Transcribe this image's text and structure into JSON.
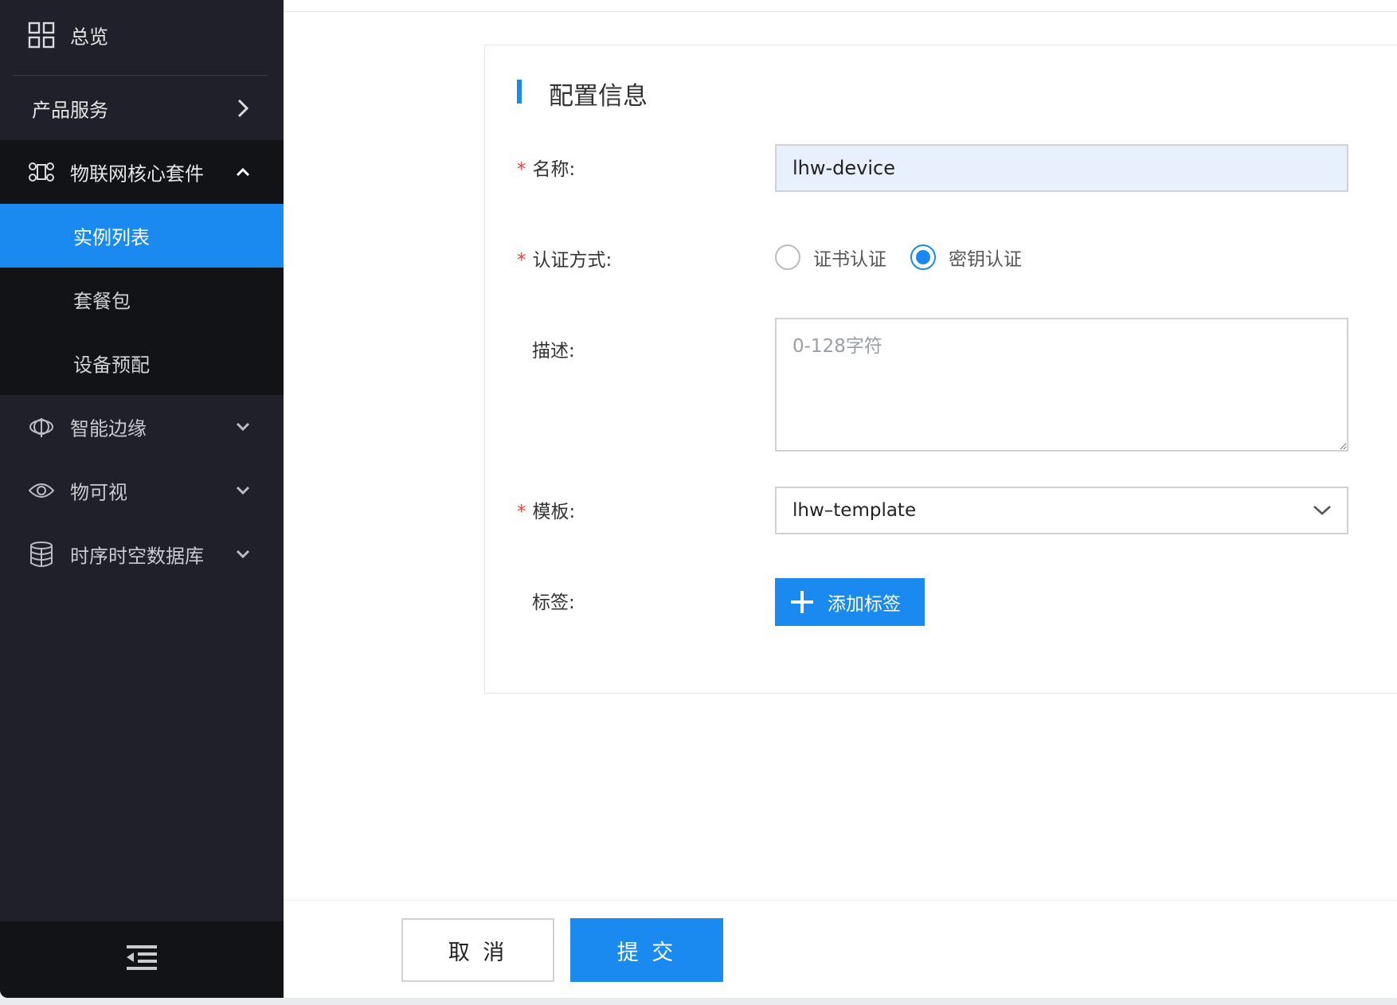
{
  "sidebar": {
    "overview": "总览",
    "product_services": "产品服务",
    "iot_core": "物联网核心套件",
    "sub_items": [
      {
        "label": "实例列表",
        "active": true
      },
      {
        "label": "套餐包",
        "active": false
      },
      {
        "label": "设备预配",
        "active": false
      }
    ],
    "smart_edge": "智能边缘",
    "visual": "物可视",
    "tsdb": "时序时空数据库"
  },
  "form": {
    "section_title": "配置信息",
    "name_label": "名称",
    "name_value": "lhw-device",
    "auth_label": "认证方式",
    "auth_options": [
      "证书认证",
      "密钥认证"
    ],
    "auth_selected": "密钥认证",
    "desc_label": "描述",
    "desc_placeholder": "0-128字符",
    "template_label": "模板",
    "template_value": "lhw–template",
    "tag_label": "标签",
    "add_tag_label": "添加标签",
    "colon": ":"
  },
  "footer": {
    "cancel_label": "取 消",
    "submit_label": "提 交"
  },
  "colors": {
    "accent": "#1a8af0",
    "sidebar_bg": "#1f2029",
    "sidebar_dark": "#121317",
    "required": "#e64340"
  }
}
